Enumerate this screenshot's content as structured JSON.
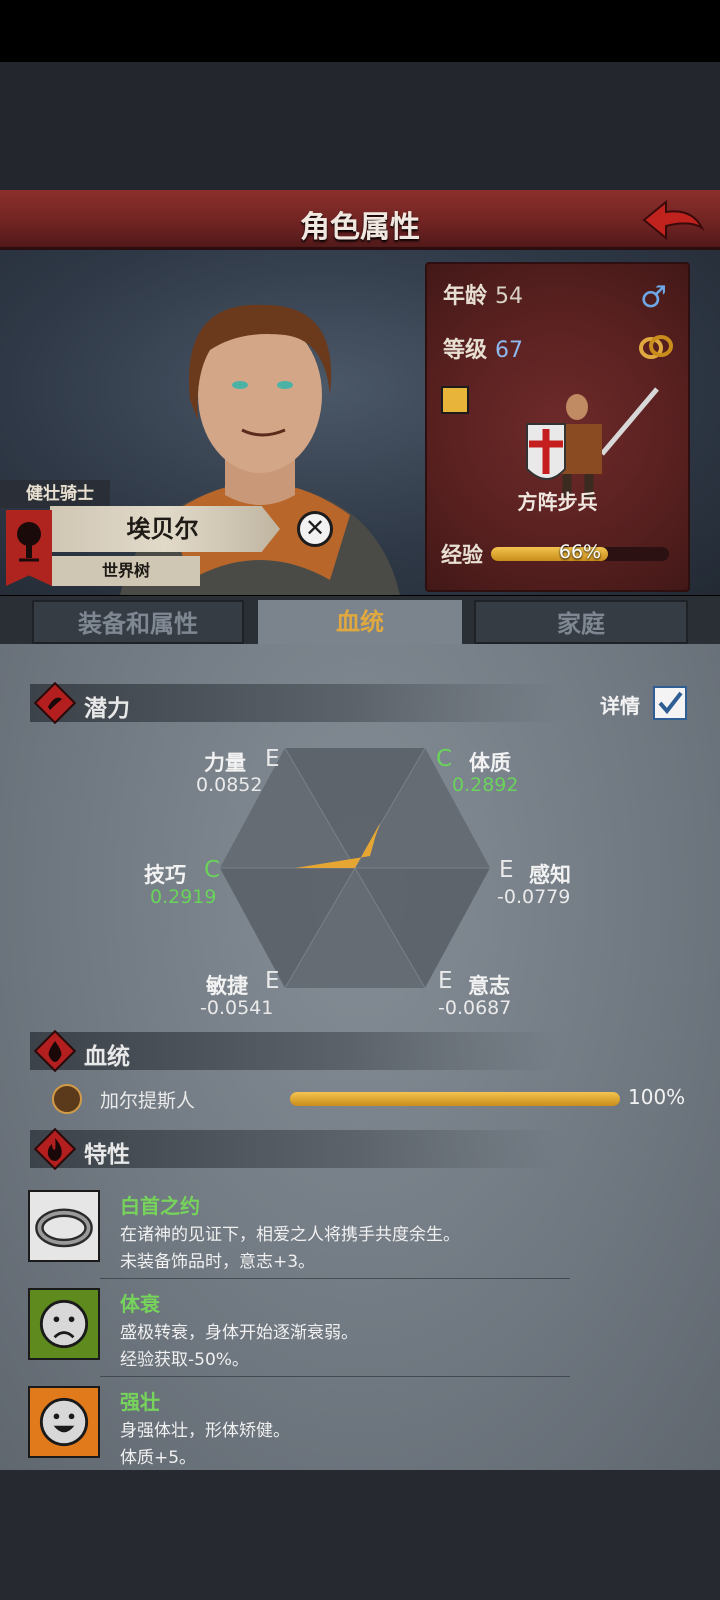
{
  "header": {
    "title": "角色属性"
  },
  "character": {
    "title_tag": "健壮骑士",
    "name": "埃贝尔",
    "faction": "世界树"
  },
  "stats": {
    "age_label": "年龄",
    "age": "54",
    "level_label": "等级",
    "level": "67",
    "unit_name": "方阵步兵",
    "exp_label": "经验",
    "exp_text": "66%",
    "exp_fraction": 0.66
  },
  "tabs": [
    {
      "label": "装备和属性",
      "active": false
    },
    {
      "label": "血统",
      "active": true
    },
    {
      "label": "家庭",
      "active": false
    }
  ],
  "potential": {
    "title": "潜力",
    "detail_label": "详情",
    "detail_checked": true,
    "attributes": [
      {
        "name": "力量",
        "grade": "E",
        "value": "0.0852"
      },
      {
        "name": "体质",
        "grade": "C",
        "value": "0.2892"
      },
      {
        "name": "技巧",
        "grade": "C",
        "value": "0.2919"
      },
      {
        "name": "感知",
        "grade": "E",
        "value": "-0.0779"
      },
      {
        "name": "敏捷",
        "grade": "E",
        "value": "-0.0541"
      },
      {
        "name": "意志",
        "grade": "E",
        "value": "-0.0687"
      }
    ]
  },
  "bloodline": {
    "title": "血统",
    "items": [
      {
        "name": "加尔提斯人",
        "percent_text": "100%",
        "fraction": 1.0
      }
    ]
  },
  "traits": {
    "title": "特性",
    "items": [
      {
        "name": "白首之约",
        "desc1": "在诸神的见证下，相爱之人将携手共度余生。",
        "desc2": "未装备饰品时，意志+3。",
        "icon": "ring-icon"
      },
      {
        "name": "体衰",
        "desc1": "盛极转衰，身体开始逐渐衰弱。",
        "desc2": "经验获取-50%。",
        "icon": "sad-face-icon"
      },
      {
        "name": "强壮",
        "desc1": "身强体壮，形体矫健。",
        "desc2": "体质+5。",
        "icon": "happy-face-icon"
      }
    ]
  },
  "colors": {
    "accent_gold": "#e0a93f",
    "grade_green": "#6ad35b",
    "header_red": "#8c2f2b"
  }
}
